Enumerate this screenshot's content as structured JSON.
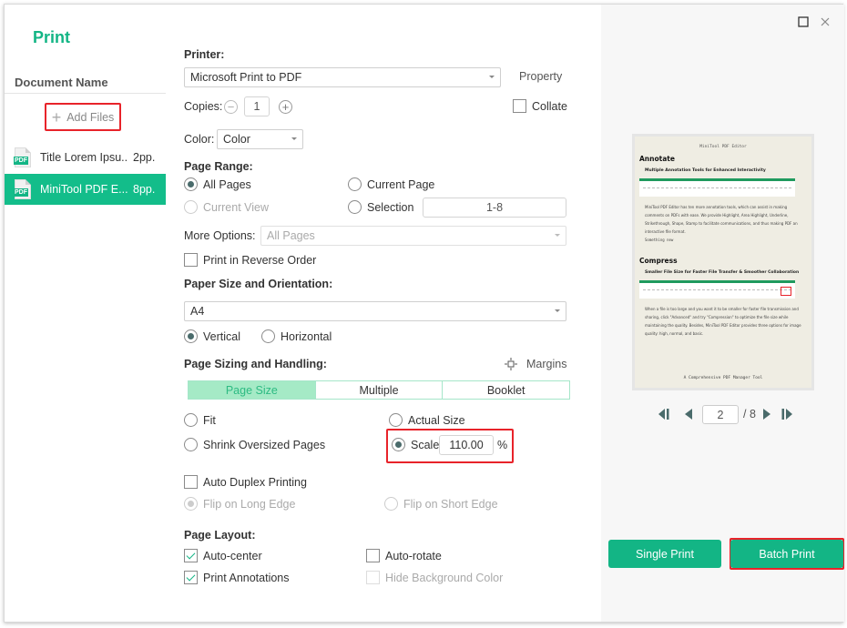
{
  "window": {
    "title": "Print",
    "maximize_icon": "maximize-icon",
    "close_icon": "close-icon"
  },
  "sidebar": {
    "title": "Print",
    "document_name_header": "Document Name",
    "add_files_label": "Add Files",
    "documents": [
      {
        "name": "Title Lorem Ipsu..",
        "pages": "2pp.",
        "selected": false
      },
      {
        "name": "MiniTool PDF E...",
        "pages": "8pp.",
        "selected": true
      }
    ]
  },
  "printer": {
    "label": "Printer:",
    "selected": "Microsoft Print to PDF",
    "property_label": "Property",
    "copies_label": "Copies:",
    "copies_value": "1",
    "collate_label": "Collate",
    "collate_checked": false,
    "color_label": "Color:",
    "color_value": "Color"
  },
  "page_range": {
    "label": "Page Range:",
    "all_pages": "All Pages",
    "current_page": "Current Page",
    "current_view": "Current View",
    "selection": "Selection",
    "selection_value": "1-8",
    "selected_option": "All Pages",
    "more_options_label": "More Options:",
    "more_options_value": "All Pages",
    "reverse_order_label": "Print in Reverse Order",
    "reverse_order_checked": false
  },
  "paper": {
    "label": "Paper Size and Orientation:",
    "size": "A4",
    "vertical": "Vertical",
    "horizontal": "Horizontal",
    "orientation": "Vertical"
  },
  "sizing": {
    "label": "Page Sizing and Handling:",
    "margins_label": "Margins",
    "tabs": [
      "Page Size",
      "Multiple",
      "Booklet"
    ],
    "active_tab": "Page Size",
    "fit": "Fit",
    "actual_size": "Actual Size",
    "shrink": "Shrink Oversized Pages",
    "scale": "Scale",
    "scale_value": "110.00",
    "scale_unit": "%",
    "selected_option": "Scale",
    "duplex_label": "Auto Duplex Printing",
    "duplex_checked": false,
    "flip_long": "Flip on Long Edge",
    "flip_short": "Flip on Short Edge"
  },
  "layout": {
    "label": "Page Layout:",
    "auto_center": "Auto-center",
    "auto_rotate": "Auto-rotate",
    "print_annotations": "Print Annotations",
    "hide_background": "Hide Background Color"
  },
  "preview": {
    "thumb": {
      "header": "MiniTool PDF Editor",
      "h1_a": "Annotate",
      "h2_a": "Multiple Annotation Tools for Enhanced Interactivity",
      "body_a": "MiniTool PDF Editor has ten more annotation tools, which can assist in making comments on PDFs with ease. We provide Highlight, Area Highlight, Underline, Strikethrough, Shape, Stamp to facilitate communications, and thus making PDF an interactive file format.",
      "mono_a": "Something new",
      "h1_b": "Compress",
      "h2_b": "Smaller File Size for Faster File Transfer & Smoother Collaboration",
      "body_b": "When a file is too large and you want it to be smaller for faster file transmission and sharing, click \"Advanced\" and try \"Compression\" to optimize the file size while maintaining the quality. Besides, MiniTool PDF Editor provides three options for image quality: high, normal, and basic.",
      "footer": "A Comprehensive PDF Manager Tool"
    },
    "current_page": "2",
    "total_pages": "/ 8",
    "single_print": "Single Print",
    "batch_print": "Batch Print"
  },
  "colors": {
    "accent": "#13b585",
    "selected_row": "#13bd8a",
    "active_tab": "#a5eac6",
    "highlight_box": "#e8232a"
  }
}
